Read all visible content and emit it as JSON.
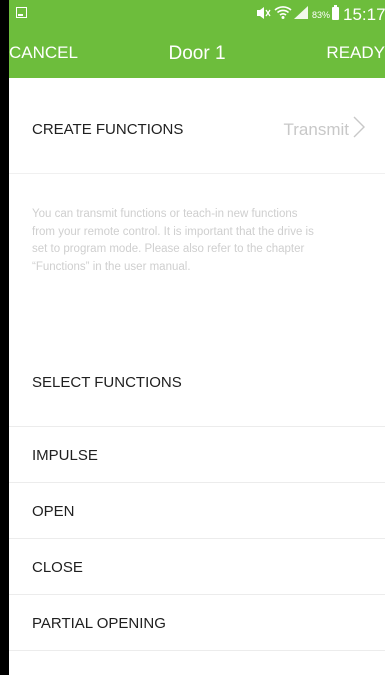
{
  "status_bar": {
    "time": "15:17",
    "battery": "83%",
    "icons": [
      "image-notification-icon",
      "mute-icon",
      "wifi-icon",
      "signal-icon",
      "battery-icon"
    ]
  },
  "action_bar": {
    "cancel_label": "CANCEL",
    "title": "Door 1",
    "ready_label": "READY",
    "color": "#6dbd3c"
  },
  "create": {
    "label": "CREATE FUNCTIONS",
    "action_label": "Transmit",
    "action_icon": "chevron-right-icon"
  },
  "info_text": "You can transmit functions or teach-in new functions from your remote control. It is important that the drive is set to program mode. Please also refer to the chapter “Functions” in the user manual.",
  "select": {
    "label": "SELECT FUNCTIONS",
    "functions": [
      "IMPULSE",
      "OPEN",
      "CLOSE",
      "PARTIAL OPENING"
    ]
  }
}
